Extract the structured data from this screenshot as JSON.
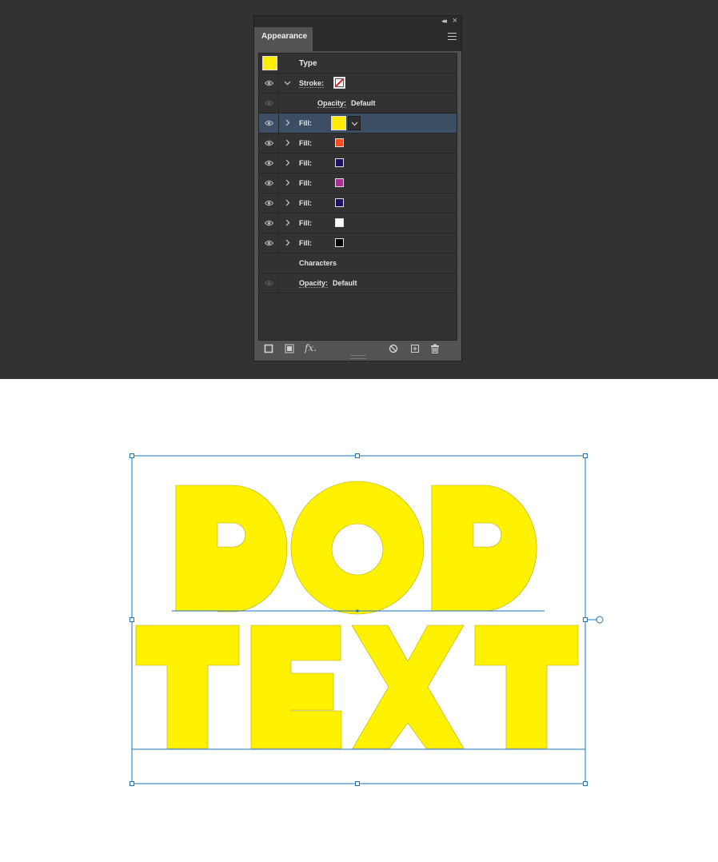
{
  "panel": {
    "tab_label": "Appearance",
    "icons": {
      "collapse": "double-chevron-left-icon",
      "close": "close-icon",
      "menu": "hamburger-menu-icon"
    },
    "header": {
      "label": "Type",
      "swatch_color": "#ffed00"
    },
    "stroke": {
      "label": "Stroke:",
      "swatch": "none-swatch"
    },
    "stroke_opacity": {
      "label": "Opacity:",
      "value": "Default"
    },
    "fills": [
      {
        "label": "Fill:",
        "color": "#ffed00",
        "selected": true
      },
      {
        "label": "Fill:",
        "color": "#f04e23"
      },
      {
        "label": "Fill:",
        "color": "#1d1160"
      },
      {
        "label": "Fill:",
        "color": "#a2318f"
      },
      {
        "label": "Fill:",
        "color": "#1d1160"
      },
      {
        "label": "Fill:",
        "color": "#ffffff"
      },
      {
        "label": "Fill:",
        "color": "#000000"
      }
    ],
    "characters": {
      "label": "Characters"
    },
    "opacity": {
      "label": "Opacity:",
      "value": "Default"
    },
    "bottom_icons": [
      "add-new-stroke-icon",
      "add-new-fill-icon",
      "fx-icon",
      "clear-appearance-icon",
      "duplicate-item-icon",
      "trash-icon"
    ],
    "fx_label": "fx."
  },
  "artwork": {
    "line1": "POP",
    "line2": "TEXT",
    "fill_color": "#fff200",
    "selection_color": "#1e73be"
  }
}
